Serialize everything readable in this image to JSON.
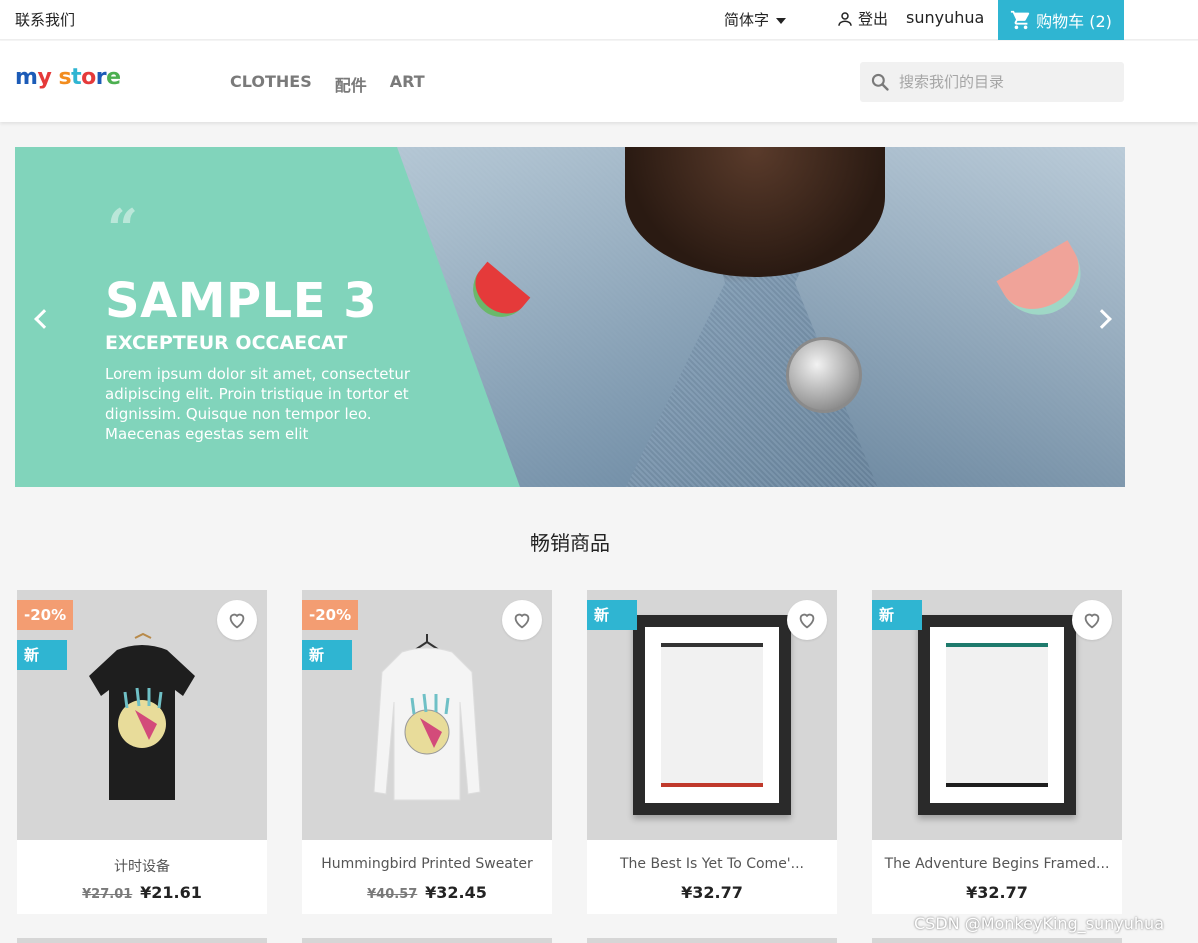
{
  "topbar": {
    "contact": "联系我们",
    "language": "简体字",
    "signout": "登出",
    "username": "sunyuhua",
    "cart": "购物车 (2)"
  },
  "header": {
    "logo": "my store",
    "nav": [
      "CLOTHES",
      "配件",
      "ART"
    ],
    "search_placeholder": "搜索我们的目录"
  },
  "hero": {
    "title": "SAMPLE 3",
    "subtitle": "EXCEPTEUR OCCAECAT",
    "text": "Lorem ipsum dolor sit amet, consectetur adipiscing elit. Proin tristique in tortor et dignissim. Quisque non tempor leo. Maecenas egestas sem elit"
  },
  "section_title": "畅销商品",
  "products": [
    {
      "name": "计时设备",
      "old_price": "¥27.01",
      "price": "¥21.61",
      "discount": "-20%",
      "new": "新"
    },
    {
      "name": "Hummingbird Printed Sweater",
      "old_price": "¥40.57",
      "price": "¥32.45",
      "discount": "-20%",
      "new": "新"
    },
    {
      "name": "The Best Is Yet To Come'...",
      "price": "¥32.77",
      "new": "新"
    },
    {
      "name": "The Adventure Begins Framed...",
      "price": "¥32.77",
      "new": "新"
    }
  ],
  "watermark": "CSDN @MonkeyKing_sunyuhua",
  "colors": {
    "accent": "#2fb5d2",
    "discount": "#f39d72",
    "hero_panel": "#81d4bb"
  }
}
